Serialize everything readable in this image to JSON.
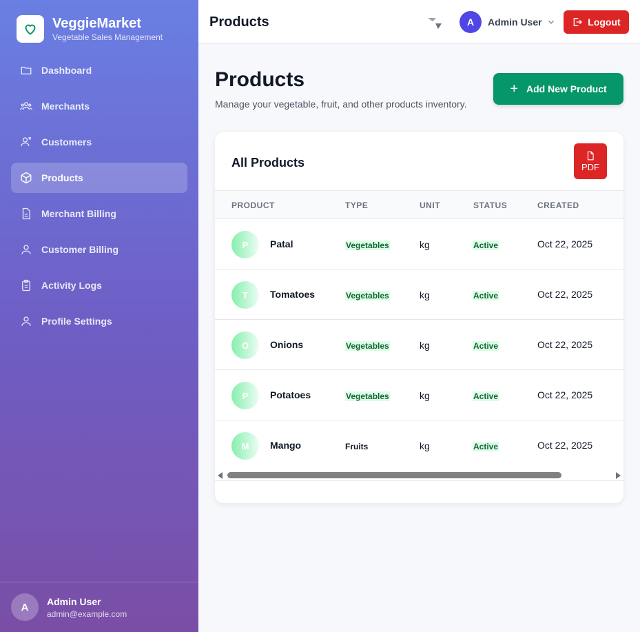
{
  "brand": {
    "name": "VeggieMarket",
    "subtitle": "Vegetable Sales Management"
  },
  "sidebar": {
    "items": [
      {
        "label": "Dashboard",
        "icon": "folder-icon"
      },
      {
        "label": "Merchants",
        "icon": "users-icon"
      },
      {
        "label": "Customers",
        "icon": "user-x-icon"
      },
      {
        "label": "Products",
        "icon": "box-icon",
        "active": true
      },
      {
        "label": "Merchant Billing",
        "icon": "document-icon"
      },
      {
        "label": "Customer Billing",
        "icon": "user-icon"
      },
      {
        "label": "Activity Logs",
        "icon": "clipboard-icon"
      },
      {
        "label": "Profile Settings",
        "icon": "user-icon"
      }
    ],
    "footer": {
      "initial": "A",
      "name": "Admin User",
      "email": "admin@example.com"
    }
  },
  "topbar": {
    "title": "Products",
    "user_initial": "A",
    "user_name": "Admin User",
    "logout_label": "Logout"
  },
  "main": {
    "title": "Products",
    "subtitle": "Manage your vegetable, fruit, and other products inventory.",
    "add_button_label": "Add New Product"
  },
  "table": {
    "title": "All Products",
    "pdf_label": "PDF",
    "columns": [
      "PRODUCT",
      "TYPE",
      "UNIT",
      "STATUS",
      "CREATED"
    ],
    "rows": [
      {
        "initial": "P",
        "name": "Patal",
        "type": "Vegetables",
        "unit": "kg",
        "status": "Active",
        "created": "Oct 22, 2025"
      },
      {
        "initial": "T",
        "name": "Tomatoes",
        "type": "Vegetables",
        "unit": "kg",
        "status": "Active",
        "created": "Oct 22, 2025"
      },
      {
        "initial": "O",
        "name": "Onions",
        "type": "Vegetables",
        "unit": "kg",
        "status": "Active",
        "created": "Oct 22, 2025"
      },
      {
        "initial": "P",
        "name": "Potatoes",
        "type": "Vegetables",
        "unit": "kg",
        "status": "Active",
        "created": "Oct 22, 2025"
      },
      {
        "initial": "M",
        "name": "Mango",
        "type": "Fruits",
        "unit": "kg",
        "status": "Active",
        "created": "Oct 22, 2025"
      }
    ]
  },
  "colors": {
    "accent": "#059669",
    "danger": "#dc2626",
    "avatar": "#4f46e5"
  }
}
